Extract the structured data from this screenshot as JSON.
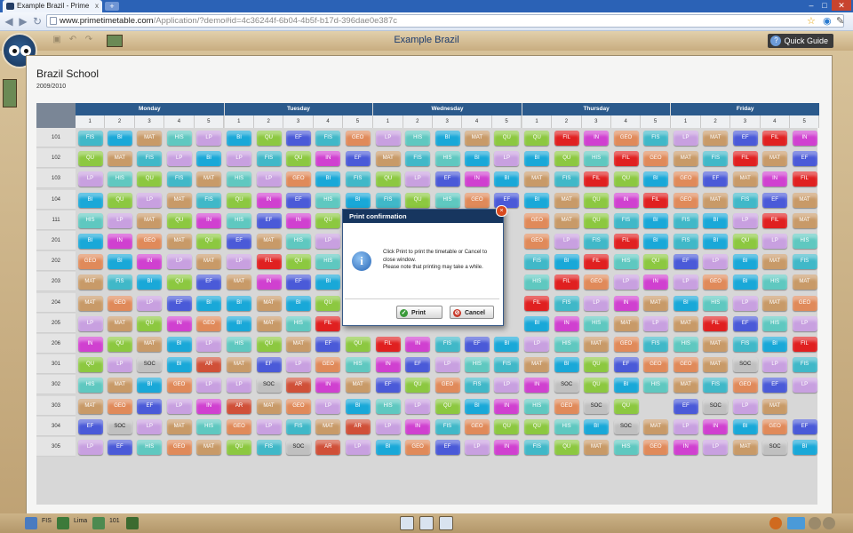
{
  "browser": {
    "tab_title": "Example Brazil - Prime Tim",
    "tab_close": "x",
    "new_tab": "+",
    "url_host": "www.primetimetable.com",
    "url_path": "/Application/?demo#id=4c36244f-6b04-4b5f-b17d-396dae0e387c",
    "icons": [
      "back-icon",
      "forward-icon",
      "reload-icon",
      "page-icon",
      "star-icon",
      "extension-icon",
      "wrench-icon"
    ]
  },
  "app": {
    "title": "Example Brazil",
    "quick_guide": "Quick Guide",
    "school_name": "Brazil School",
    "year": "2009/2010"
  },
  "timetable": {
    "days": [
      "Monday",
      "Tuesday",
      "Wednesday",
      "Thursday",
      "Friday"
    ],
    "periods": [
      "1",
      "2",
      "3",
      "4",
      "5"
    ],
    "rows": [
      {
        "label": "101",
        "cells": [
          "FIS",
          "BI",
          "MAT",
          "HIS",
          "LP",
          "BI",
          "QU",
          "EF",
          "FIS",
          "GEO",
          "LP",
          "HIS",
          "BI",
          "MAT",
          "QU",
          "QU",
          "FIL",
          "IN",
          "GEO",
          "FIS",
          "LP",
          "MAT",
          "EF",
          "FIL",
          "IN"
        ]
      },
      {
        "label": "102",
        "cells": [
          "QU",
          "MAT",
          "FIS",
          "LP",
          "BI",
          "LP",
          "FIS",
          "QU",
          "IN",
          "EF",
          "MAT",
          "FIS",
          "HIS",
          "BI",
          "LP",
          "BI",
          "QU",
          "HIS",
          "FIL",
          "GEO",
          "MAT",
          "FIS",
          "FIL",
          "MAT",
          "EF"
        ]
      },
      {
        "label": "103",
        "cells": [
          "LP",
          "HIS",
          "QU",
          "FIS",
          "MAT",
          "HIS",
          "LP",
          "GEO",
          "BI",
          "FIS",
          "QU",
          "LP",
          "EF",
          "IN",
          "BI",
          "MAT",
          "FIS",
          "FIL",
          "QU",
          "BI",
          "GEO",
          "EF",
          "MAT",
          "IN",
          "FIL"
        ]
      },
      {
        "label": "104",
        "cells": [
          "BI",
          "QU",
          "LP",
          "MAT",
          "FIS",
          "QU",
          "IN",
          "EF",
          "HIS",
          "BI",
          "FIS",
          "QU",
          "HIS",
          "GEO",
          "EF",
          "BI",
          "MAT",
          "QU",
          "IN",
          "FIL",
          "GEO",
          "MAT",
          "FIS",
          "EF",
          "MAT"
        ]
      },
      {
        "label": "111",
        "cells": [
          "HIS",
          "LP",
          "MAT",
          "QU",
          "IN",
          "HIS",
          "EF",
          "IN",
          "QU",
          "",
          "",
          "",
          "",
          "",
          "",
          "GEO",
          "MAT",
          "QU",
          "FIS",
          "BI",
          "FIS",
          "BI",
          "LP",
          "FIL",
          "MAT"
        ]
      },
      {
        "label": "201",
        "cells": [
          "BI",
          "IN",
          "GEO",
          "MAT",
          "QU",
          "EF",
          "MAT",
          "HIS",
          "LP",
          "",
          "",
          "",
          "",
          "",
          "",
          "GEO",
          "LP",
          "FIS",
          "FIL",
          "BI",
          "FIS",
          "BI",
          "QU",
          "LP",
          "HIS"
        ]
      },
      {
        "label": "202",
        "cells": [
          "GEO",
          "BI",
          "IN",
          "LP",
          "MAT",
          "LP",
          "FIL",
          "QU",
          "HIS",
          "",
          "",
          "",
          "",
          "",
          "",
          "FIS",
          "BI",
          "FIL",
          "HIS",
          "QU",
          "EF",
          "LP",
          "BI",
          "MAT",
          "FIS"
        ]
      },
      {
        "label": "203",
        "cells": [
          "MAT",
          "FIS",
          "BI",
          "QU",
          "EF",
          "MAT",
          "IN",
          "EF",
          "BI",
          "",
          "",
          "",
          "",
          "",
          "",
          "HIS",
          "FIL",
          "GEO",
          "LP",
          "IN",
          "LP",
          "GEO",
          "BI",
          "HIS",
          "MAT"
        ]
      },
      {
        "label": "204",
        "cells": [
          "MAT",
          "GEO",
          "LP",
          "EF",
          "BI",
          "BI",
          "MAT",
          "BI",
          "QU",
          "",
          "",
          "",
          "",
          "",
          "",
          "FIL",
          "FIS",
          "LP",
          "IN",
          "MAT",
          "BI",
          "HIS",
          "LP",
          "MAT",
          "GEO"
        ]
      },
      {
        "label": "205",
        "cells": [
          "LP",
          "MAT",
          "QU",
          "IN",
          "GEO",
          "BI",
          "MAT",
          "HIS",
          "FIL",
          "",
          "",
          "",
          "",
          "",
          "",
          "BI",
          "IN",
          "HIS",
          "MAT",
          "LP",
          "MAT",
          "FIL",
          "EF",
          "HIS",
          "LP"
        ]
      },
      {
        "label": "206",
        "cells": [
          "IN",
          "QU",
          "MAT",
          "BI",
          "LP",
          "HIS",
          "QU",
          "MAT",
          "EF",
          "QU",
          "FIL",
          "IN",
          "FIS",
          "EF",
          "BI",
          "LP",
          "HIS",
          "MAT",
          "GEO",
          "FIS",
          "HIS",
          "MAT",
          "FIS",
          "BI",
          "FIL"
        ]
      },
      {
        "label": "301",
        "cells": [
          "QU",
          "LP",
          "SOC",
          "BI",
          "AR",
          "MAT",
          "EF",
          "LP",
          "GEO",
          "HIS",
          "IN",
          "EF",
          "LP",
          "HIS",
          "FIS",
          "MAT",
          "BI",
          "QU",
          "EF",
          "GEO",
          "GEO",
          "MAT",
          "SOC",
          "LP",
          "FIS"
        ]
      },
      {
        "label": "302",
        "cells": [
          "HIS",
          "MAT",
          "BI",
          "GEO",
          "LP",
          "LP",
          "SOC",
          "AR",
          "IN",
          "MAT",
          "EF",
          "QU",
          "GEO",
          "FIS",
          "LP",
          "IN",
          "SOC",
          "QU",
          "BI",
          "HIS",
          "MAT",
          "FIS",
          "GEO",
          "EF",
          "LP"
        ]
      },
      {
        "label": "303",
        "cells": [
          "MAT",
          "GEO",
          "EF",
          "LP",
          "IN",
          "AR",
          "MAT",
          "GEO",
          "LP",
          "BI",
          "HIS",
          "LP",
          "QU",
          "BI",
          "IN",
          "HIS",
          "GEO",
          "SOC",
          "QU",
          "",
          "EF",
          "SOC",
          "LP",
          "MAT",
          ""
        ]
      },
      {
        "label": "304",
        "cells": [
          "EF",
          "SOC",
          "LP",
          "MAT",
          "HIS",
          "GEO",
          "LP",
          "FIS",
          "MAT",
          "AR",
          "LP",
          "IN",
          "FIS",
          "GEO",
          "QU",
          "QU",
          "HIS",
          "BI",
          "SOC",
          "MAT",
          "LP",
          "IN",
          "BI",
          "GEO",
          "EF"
        ]
      },
      {
        "label": "305",
        "cells": [
          "LP",
          "EF",
          "HIS",
          "GEO",
          "MAT",
          "QU",
          "FIS",
          "SOC",
          "AR",
          "LP",
          "BI",
          "GEO",
          "EF",
          "LP",
          "IN",
          "FIS",
          "QU",
          "MAT",
          "HIS",
          "GEO",
          "IN",
          "LP",
          "MAT",
          "SOC",
          "BI"
        ]
      }
    ]
  },
  "subject_colors": {
    "FIS": "#40b8c8",
    "BI": "#19a8d8",
    "MAT": "#c89a68",
    "HIS": "#5fc8c0",
    "LP": "#c8a0e0",
    "QU": "#8cc840",
    "EF": "#4a5ad8",
    "GEO": "#e08a5a",
    "IN": "#d040d0",
    "FIL": "#e02020",
    "SOC": "#c0c0c0",
    "AR": "#d05038"
  },
  "dialog": {
    "title": "Print confirmation",
    "message_1": "Click Print to print the timetable or Cancel to close window.",
    "message_2": "Please note that printing may take a while.",
    "print_label": "Print",
    "cancel_label": "Cancel"
  },
  "statusbar": {
    "subject": "FIS",
    "teacher": "Lima",
    "room": "101"
  }
}
